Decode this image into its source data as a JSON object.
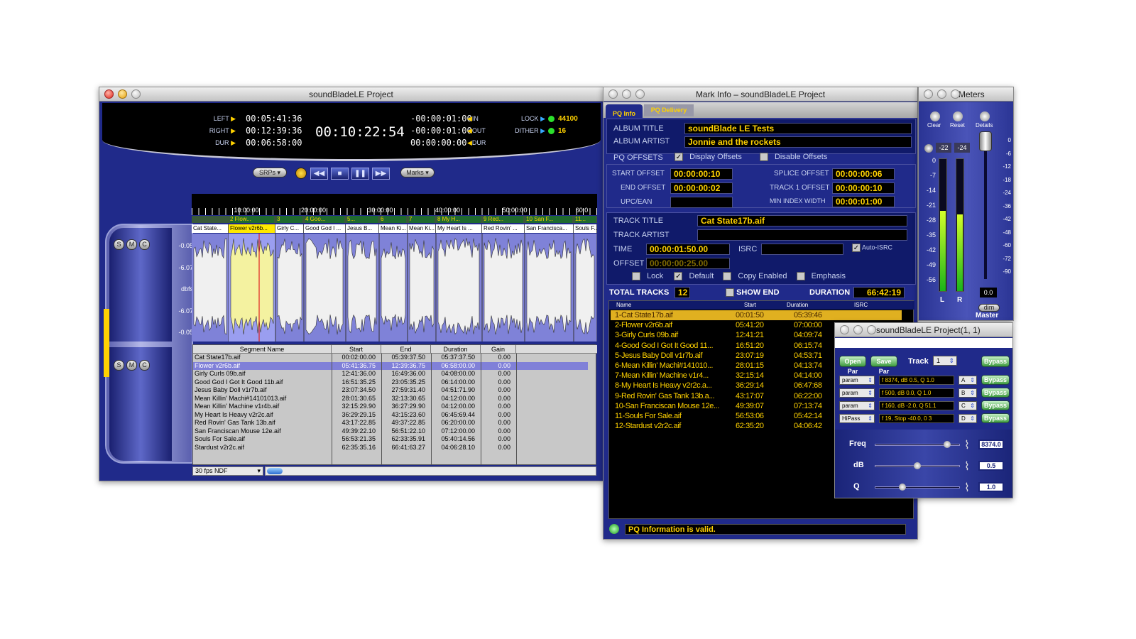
{
  "main_window": {
    "title": "soundBladeLE Project",
    "transport": {
      "left_label": "LEFT",
      "left_value": "00:05:41:36",
      "right_label": "RIGHT",
      "right_value": "00:12:39:36",
      "dur_label": "DUR",
      "dur_value": "00:06:58:00",
      "big_time": "00:10:22:54",
      "in_value": "-00:00:01:00",
      "in_label": "IN",
      "out_value": "-00:00:01:00",
      "out_label": "OUT",
      "dur2_value": "00:00:00:00",
      "dur2_label": "DUR",
      "lock_label": "LOCK",
      "lock_value": "44100",
      "dither_label": "DITHER",
      "dither_value": "16"
    },
    "buttons": {
      "srps": "SRPs",
      "marks": "Marks",
      "rewind": "◀◀",
      "stop": "■",
      "pause": "❚❚",
      "ffwd": "▶▶"
    },
    "ruler_ticks": [
      "10:00:00",
      "20:00:00",
      "30:00:00",
      "40:00:00",
      "50:00:00",
      "60:0"
    ],
    "marker_labels": [
      "2 Flow...",
      "3",
      "4 Goo...",
      "5...",
      "6",
      "7",
      "8 My H...",
      "9 Red...",
      "10 San F...",
      "11..."
    ],
    "segment_labels": [
      "Cat State...",
      "Flower v2r6b...",
      "Girly C...",
      "Good God I ...",
      "Jesus B...",
      "Mean Ki...",
      "Mean Ki...",
      "My Heart Is ...",
      "Red Rovin' ...",
      "San Francisca...",
      "Souls F..."
    ],
    "db_scale": [
      "-0.05",
      "-6.07",
      "dbfs",
      "-6.07",
      "-0.05"
    ],
    "smc": [
      "S",
      "M",
      "C"
    ],
    "segment_table": {
      "headers": [
        "Segment Name",
        "Start",
        "End",
        "Duration",
        "Gain"
      ],
      "rows": [
        [
          "Cat State17b.aif",
          "00:02:00.00",
          "05:39:37.50",
          "05:37:37.50",
          "0.00"
        ],
        [
          "Flower v2r6b.aif",
          "05:41:36.75",
          "12:39:36.75",
          "06:58:00.00",
          "0.00"
        ],
        [
          "Girly Curls 09b.aif",
          "12:41:36.00",
          "16:49:36.00",
          "04:08:00.00",
          "0.00"
        ],
        [
          "Good God I Got It Good 11b.aif",
          "16:51:35.25",
          "23:05:35.25",
          "06:14:00.00",
          "0.00"
        ],
        [
          "Jesus Baby Doll v1r7b.aif",
          "23:07:34.50",
          "27:59:31.40",
          "04:51:71.90",
          "0.00"
        ],
        [
          "Mean Killin' Machi#14101013.aif",
          "28:01:30.65",
          "32:13:30.65",
          "04:12:00.00",
          "0.00"
        ],
        [
          "Mean Killin' Machine v1r4b.aif",
          "32:15:29.90",
          "36:27:29.90",
          "04:12:00.00",
          "0.00"
        ],
        [
          "My Heart Is Heavy v2r2c.aif",
          "36:29:29.15",
          "43:15:23.60",
          "06:45:69.44",
          "0.00"
        ],
        [
          "Red Rovin' Gas Tank 13b.aif",
          "43:17:22.85",
          "49:37:22.85",
          "06:20:00.00",
          "0.00"
        ],
        [
          "San Franciscan Mouse 12e.aif",
          "49:39:22.10",
          "56:51:22.10",
          "07:12:00.00",
          "0.00"
        ],
        [
          "Souls For Sale.aif",
          "56:53:21.35",
          "62:33:35.91",
          "05:40:14.56",
          "0.00"
        ],
        [
          "Stardust v2r2c.aif",
          "62:35:35.16",
          "66:41:63.27",
          "04:06:28.10",
          "0.00"
        ]
      ]
    },
    "fps_select": "30 fps NDF"
  },
  "mark_window": {
    "title": "Mark Info – soundBladeLE Project",
    "tabs": [
      "PQ Info",
      "PQ Delivery"
    ],
    "album_title_label": "ALBUM TITLE",
    "album_title": "soundBlade LE Tests",
    "album_artist_label": "ALBUM ARTIST",
    "album_artist": "Jonnie and the rockets",
    "pq_offsets_label": "PQ OFFSETS",
    "display_offsets": "Display Offsets",
    "disable_offsets": "Disable Offsets",
    "start_offset_label": "START OFFSET",
    "start_offset": "00:00:00:10",
    "end_offset_label": "END OFFSET",
    "end_offset": "00:00:00:02",
    "upc_label": "UPC/EAN",
    "splice_offset_label": "SPLICE OFFSET",
    "splice_offset": "00:00:00:06",
    "track1_offset_label": "TRACK 1 OFFSET",
    "track1_offset": "00:00:00:10",
    "min_index_label": "MIN INDEX WIDTH",
    "min_index": "00:00:01:00",
    "track_title_label": "TRACK TITLE",
    "track_title": "Cat State17b.aif",
    "track_artist_label": "TRACK ARTIST",
    "time_label": "TIME",
    "time_value": "00:00:01:50.00",
    "isrc_label": "ISRC",
    "auto_isrc": "Auto-ISRC",
    "offset_label": "OFFSET",
    "offset_value": "00:00:00:25.00",
    "lock": "Lock",
    "default": "Default",
    "copy_enabled": "Copy Enabled",
    "emphasis": "Emphasis",
    "total_tracks_label": "TOTAL TRACKS",
    "total_tracks": "12",
    "show_end": "SHOW END",
    "duration_label": "DURATION",
    "duration": "66:42:19",
    "track_headers": [
      "Name",
      "Start",
      "Duration",
      "ISRC"
    ],
    "tracks": [
      [
        "1-Cat State17b.aif",
        "00:01:50",
        "05:39:46"
      ],
      [
        "2-Flower v2r6b.aif",
        "05:41:20",
        "07:00:00"
      ],
      [
        "3-Girly Curls 09b.aif",
        "12:41:21",
        "04:09:74"
      ],
      [
        "4-Good God I Got It Good 11...",
        "16:51:20",
        "06:15:74"
      ],
      [
        "5-Jesus Baby Doll v1r7b.aif",
        "23:07:19",
        "04:53:71"
      ],
      [
        "6-Mean Killin' Machi#141010...",
        "28:01:15",
        "04:13:74"
      ],
      [
        "7-Mean Killin' Machine v1r4...",
        "32:15:14",
        "04:14:00"
      ],
      [
        "8-My Heart Is Heavy v2r2c.a...",
        "36:29:14",
        "06:47:68"
      ],
      [
        "9-Red Rovin' Gas Tank 13b.a...",
        "43:17:07",
        "06:22:00"
      ],
      [
        "10-San Franciscan Mouse 12e...",
        "49:39:07",
        "07:13:74"
      ],
      [
        "11-Souls For Sale.aif",
        "56:53:06",
        "05:42:14"
      ],
      [
        "12-Stardust v2r2c.aif",
        "62:35:20",
        "04:06:42"
      ]
    ],
    "status": "PQ Information is valid."
  },
  "meters_window": {
    "title": "Meters",
    "clear": "Clear",
    "reset": "Reset",
    "details": "Details",
    "peak_l": "-22",
    "peak_r": "-24",
    "scale": [
      "0",
      "-7",
      "-14",
      "-21",
      "-28",
      "-35",
      "-42",
      "-49",
      "-56"
    ],
    "right_scale": [
      "0",
      "-6",
      "-12",
      "-18",
      "-24",
      "-36",
      "-42",
      "-48",
      "-60",
      "-72",
      "-90"
    ],
    "l_label": "L",
    "r_label": "R",
    "master_value": "0.0",
    "dim": "dim",
    "master": "Master",
    "level_l": 0.61,
    "level_r": 0.58
  },
  "eq_window": {
    "title": "soundBladeLE Project(1, 1)",
    "open_par": "Open Par",
    "save_par": "Save Par",
    "track_label": "Track",
    "track_value": "1",
    "bypass": "Bypass",
    "bands": [
      {
        "type": "param",
        "value": "f 8374, dB 0.5, Q 1.0",
        "letter": "A"
      },
      {
        "type": "param",
        "value": "f 500, dB 0.0, Q 1.0",
        "letter": "B"
      },
      {
        "type": "param",
        "value": "f 160, dB -2.0, Q 51.1",
        "letter": "C"
      },
      {
        "type": "HiPass",
        "value": "f 19, Stop -40.0, 0 3",
        "letter": "D"
      }
    ],
    "freq_label": "Freq",
    "freq_value": "8374.0",
    "freq_level": 0.86,
    "db_label": "dB",
    "db_value": "0.5",
    "db_level": 0.5,
    "q_label": "Q",
    "q_value": "1.0",
    "q_level": 0.32
  }
}
